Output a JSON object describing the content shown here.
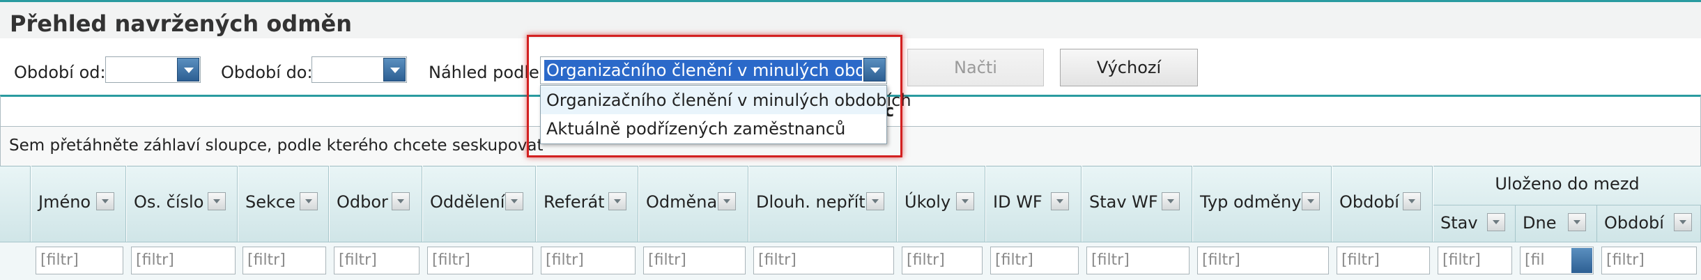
{
  "page": {
    "title": "Přehled navržených odměn"
  },
  "filters": {
    "period_from_label": "Období od:",
    "period_to_label": "Období do:",
    "view_label": "Náhled podle:",
    "view_selected": "Organizačního členění v minulých obdobích",
    "view_options": [
      "Organizačního členění v minulých obdobích",
      "Aktuálně podřízených zaměstnanců"
    ]
  },
  "buttons": {
    "load": "Načti",
    "default": "Výchozí"
  },
  "grid": {
    "group_header_partial": "c",
    "drag_hint": "Sem přetáhněte záhlaví sloupce, podle kterého chcete seskupovat",
    "columns": [
      "Jméno",
      "Os. číslo",
      "Sekce",
      "Odbor",
      "Oddělení",
      "Referát",
      "Odměna",
      "Dlouh. nepřít.",
      "Úkoly",
      "ID WF",
      "Stav WF",
      "Typ odměny",
      "Období"
    ],
    "group_title": "Uloženo do mezd",
    "group_columns": [
      "Stav",
      "Dne",
      "Období"
    ],
    "filter_placeholder": "[filtr]",
    "filter_placeholder_short": "[fil"
  },
  "colors": {
    "accent": "#2a9ba0",
    "highlight_border": "#d32020",
    "selection": "#2b69c9"
  }
}
